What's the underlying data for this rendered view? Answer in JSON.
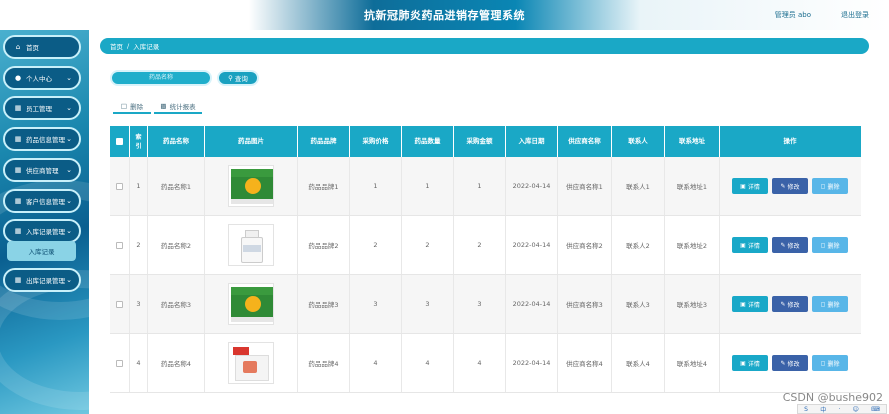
{
  "header": {
    "title": "抗新冠肺炎药品进销存管理系统",
    "user": "管理员 abo",
    "logout": "退出登录"
  },
  "sidebar": {
    "items": [
      {
        "label": "首页",
        "icon": "home-icon",
        "glyph": "⌂",
        "chevron": false
      },
      {
        "label": "个人中心",
        "icon": "user-icon",
        "glyph": "●",
        "chevron": true
      },
      {
        "label": "员工管理",
        "icon": "grid-icon",
        "glyph": "▦",
        "chevron": true
      },
      {
        "label": "药品信息管理",
        "icon": "grid-icon",
        "glyph": "▦",
        "chevron": true
      },
      {
        "label": "供应商管理",
        "icon": "grid-icon",
        "glyph": "▦",
        "chevron": true
      },
      {
        "label": "客户信息管理",
        "icon": "grid-icon",
        "glyph": "▦",
        "chevron": true
      },
      {
        "label": "入库记录管理",
        "icon": "grid-icon",
        "glyph": "▦",
        "chevron": true
      },
      {
        "label": "出库记录管理",
        "icon": "grid-icon",
        "glyph": "▦",
        "chevron": true
      }
    ],
    "subitem": "入库记录"
  },
  "breadcrumb": {
    "home": "首页",
    "separator": "/",
    "current": "入库记录"
  },
  "search": {
    "placeholder": "药品名称",
    "button": "查询"
  },
  "tabs": {
    "delete": "删除",
    "stats": "统计报表"
  },
  "table": {
    "headers": [
      "索引",
      "药品名称",
      "药品图片",
      "药品品牌",
      "采购价格",
      "药品数量",
      "采购金额",
      "入库日期",
      "供应商名称",
      "联系人",
      "联系地址",
      "操作"
    ],
    "rows": [
      {
        "index": "1",
        "name": "药品名称1",
        "image": "box",
        "brand": "药品品牌1",
        "price": "1",
        "qty": "1",
        "amount": "1",
        "date": "2022-04-14",
        "supplier": "供应商名称1",
        "contact": "联系人1",
        "address": "联系地址1"
      },
      {
        "index": "2",
        "name": "药品名称2",
        "image": "bottle",
        "brand": "药品品牌2",
        "price": "2",
        "qty": "2",
        "amount": "2",
        "date": "2022-04-14",
        "supplier": "供应商名称2",
        "contact": "联系人2",
        "address": "联系地址2"
      },
      {
        "index": "3",
        "name": "药品名称3",
        "image": "box",
        "brand": "药品品牌3",
        "price": "3",
        "qty": "3",
        "amount": "3",
        "date": "2022-04-14",
        "supplier": "供应商名称3",
        "contact": "联系人3",
        "address": "联系地址3"
      },
      {
        "index": "4",
        "name": "药品名称4",
        "image": "pack",
        "brand": "药品品牌4",
        "price": "4",
        "qty": "4",
        "amount": "4",
        "date": "2022-04-14",
        "supplier": "供应商名称4",
        "contact": "联系人4",
        "address": "联系地址4"
      }
    ],
    "actions": {
      "detail": "详情",
      "edit": "修改",
      "delete": "删除"
    }
  },
  "watermark": "CSDN @bushe902",
  "tray": [
    "S",
    "中",
    "·",
    "☺",
    "⌨"
  ],
  "colors": {
    "accent": "#1aa8c6",
    "edit": "#3a62a8",
    "delete": "#58b6e8",
    "sidebar": "#0b5c86"
  }
}
